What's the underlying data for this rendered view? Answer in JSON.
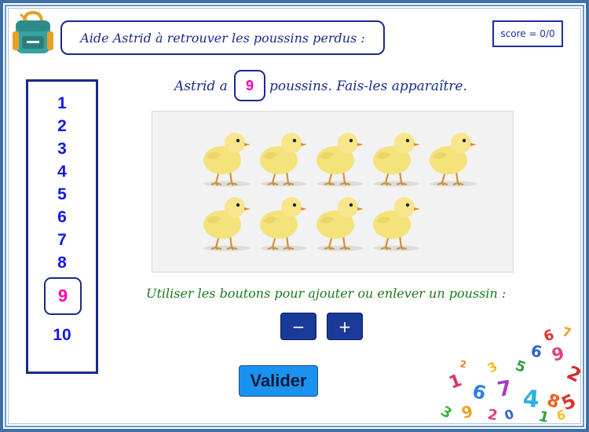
{
  "title": "Aide Astrid à retrouver les poussins perdus :",
  "score": "score = 0/0",
  "sentence": {
    "before": "Astrid a",
    "count": "9",
    "after": "poussins. Fais-les apparaître."
  },
  "number_list": [
    "1",
    "2",
    "3",
    "4",
    "5",
    "6",
    "7",
    "8",
    "9",
    "10"
  ],
  "selected_number": "9",
  "chicks_shown": 9,
  "instruction": "Utiliser les boutons pour ajouter ou enlever un poussin :",
  "buttons": {
    "minus": "−",
    "plus": "+",
    "validate": "Valider"
  },
  "colors": {
    "frame": "#3d6fa8",
    "title_text": "#1a2a8a",
    "number_text": "#1515e8",
    "highlight": "#ff00aa",
    "instruction": "#1a7a1a",
    "button": "#1a3a9a",
    "validate_button": "#1a93f0"
  },
  "icons": {
    "backpack": "backpack-icon",
    "chick": "chick-image",
    "numbers_decoration": "colorful-numbers-decoration"
  }
}
